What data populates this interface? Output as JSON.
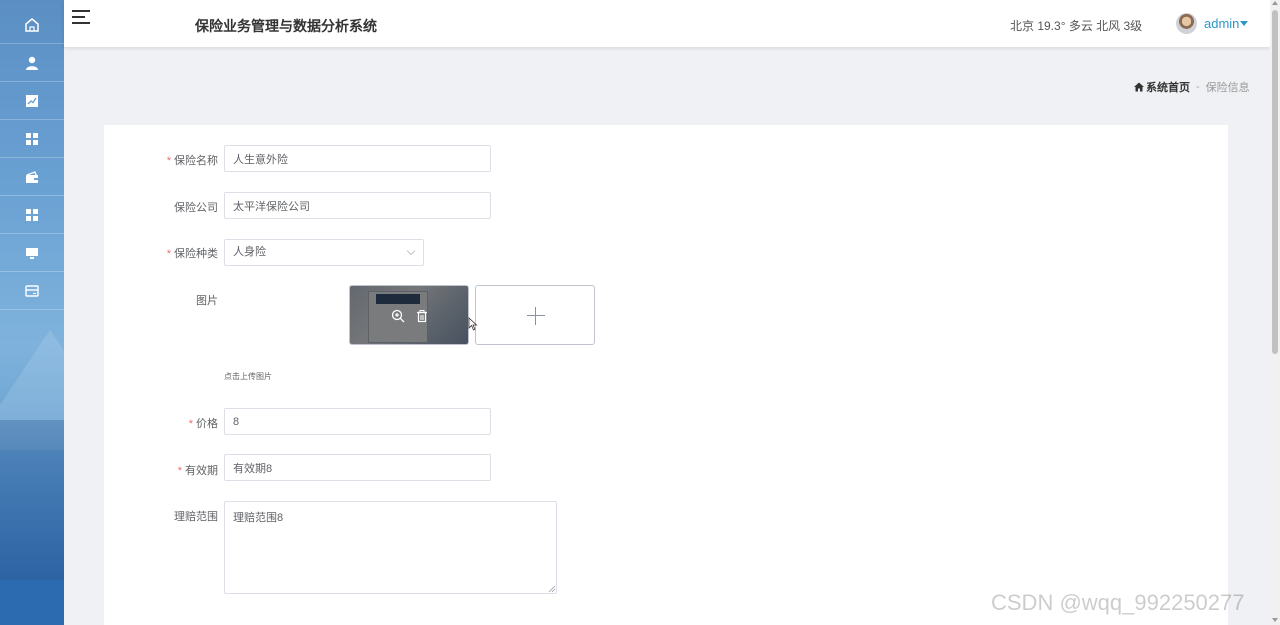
{
  "sidebar": {
    "items": [
      {
        "icon": "home-icon"
      },
      {
        "icon": "user-icon"
      },
      {
        "icon": "chart-icon"
      },
      {
        "icon": "grid-icon"
      },
      {
        "icon": "wallet-icon"
      },
      {
        "icon": "grid-icon"
      },
      {
        "icon": "monitor-icon"
      },
      {
        "icon": "card-icon"
      }
    ]
  },
  "header": {
    "title": "保险业务管理与数据分析系统",
    "weather": "北京 19.3° 多云 北风 3级",
    "username": "admin"
  },
  "breadcrumb": {
    "home": "系统首页",
    "separator": "-",
    "current": "保险信息"
  },
  "form": {
    "name": {
      "label": "保险名称",
      "required": true,
      "value": "人生意外险"
    },
    "company": {
      "label": "保险公司",
      "required": false,
      "value": "太平洋保险公司"
    },
    "type": {
      "label": "保险种类",
      "required": true,
      "value": "人身险"
    },
    "image": {
      "label": "图片",
      "hint": "点击上传图片"
    },
    "price": {
      "label": "价格",
      "required": true,
      "value": "8"
    },
    "validity": {
      "label": "有效期",
      "required": true,
      "value": "有效期8"
    },
    "coverage": {
      "label": "理赔范围",
      "required": false,
      "value": "理赔范围8"
    }
  },
  "watermark": "CSDN @wqq_992250277",
  "colors": {
    "accent": "#2a97c7",
    "required": "#f56c6c",
    "border": "#dcdfe6"
  }
}
